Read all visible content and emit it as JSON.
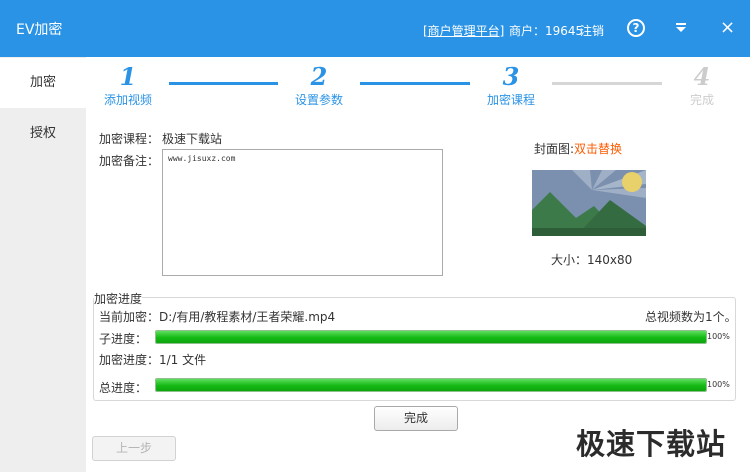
{
  "window": {
    "title": "EV加密",
    "merchant_platform_link": "[商户管理平台]",
    "merchant_id_text": "商户：19645",
    "logout_label": "注销",
    "help_glyph": "?",
    "close_glyph": "×",
    "accent_color": "#2a93e6"
  },
  "sidebar": {
    "items": [
      {
        "label": "加密",
        "active": true
      },
      {
        "label": "授权",
        "active": false
      }
    ]
  },
  "steps": [
    {
      "number": "1",
      "label": "添加视频",
      "state": "complete"
    },
    {
      "number": "2",
      "label": "设置参数",
      "state": "complete"
    },
    {
      "number": "3",
      "label": "加密课程",
      "state": "current"
    },
    {
      "number": "4",
      "label": "完成",
      "state": "pending"
    }
  ],
  "form": {
    "course_label": "加密课程：",
    "course_value": "极速下载站",
    "note_label": "加密备注：",
    "note_value": "www.jisuxz.com"
  },
  "cover": {
    "title_prefix": "封面图:",
    "title_action": "双击替换",
    "size_text": "大小：140x80",
    "action_color": "#ff5a00"
  },
  "progress": {
    "group_title": "加密进度",
    "current_label": "当前加密：",
    "current_file": "D:/有用/教程素材/王者荣耀.mp4",
    "total_videos_text": "总视频数为1个。",
    "sub_label": "子进度：",
    "sub_percent": "100%",
    "sub_value": 1.0,
    "file_progress_text": "加密进度：1/1 文件",
    "total_label": "总进度：",
    "total_percent": "100%",
    "total_value": 1.0
  },
  "buttons": {
    "finish_label": "完成",
    "prev_label": "上一步"
  },
  "watermark": "极速下载站"
}
